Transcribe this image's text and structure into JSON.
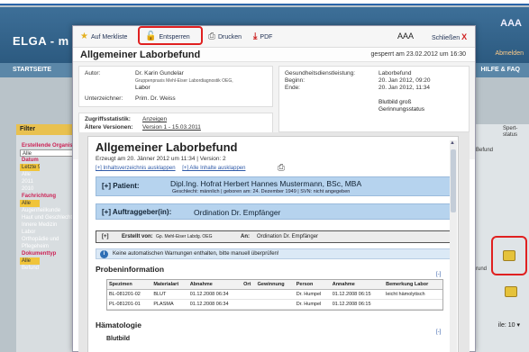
{
  "background": {
    "app_title": "ELGA - m",
    "font_size_control": "AAA",
    "logout": "Abmelden",
    "nav_start": "STARTSEITE",
    "nav_help": "HILFE & FAQ",
    "filter_title": "Filter",
    "filter_items": [
      {
        "label": "Erstellende Organisation",
        "type": "sec"
      },
      {
        "label": "Alle",
        "type": "sel"
      },
      {
        "label": "Datum",
        "type": "sec"
      },
      {
        "label": "Letzte 90 Tage",
        "type": "pill"
      },
      {
        "label": "Alle",
        "type": "plain"
      },
      {
        "label": "2011",
        "type": "plain"
      },
      {
        "label": "2010",
        "type": "plain"
      },
      {
        "label": "Fachrichtung",
        "type": "sec"
      },
      {
        "label": "Alle",
        "type": "pill"
      },
      {
        "label": "Augenheilkunde",
        "type": "plain"
      },
      {
        "label": "Haut und Geschlecht",
        "type": "plain"
      },
      {
        "label": "Innere Medizin",
        "type": "plain"
      },
      {
        "label": "Labor",
        "type": "plain"
      },
      {
        "label": "Orthopädie und",
        "type": "plain"
      },
      {
        "label": "Pflegeheim",
        "type": "plain"
      },
      {
        "label": "Dokumenttyp",
        "type": "sec"
      },
      {
        "label": "Alle",
        "type": "pill"
      },
      {
        "label": "Befund",
        "type": "plain"
      }
    ],
    "right_labels": [
      "Spert-status",
      "Befund",
      "rund"
    ],
    "rows_per_page_label": "ile:",
    "rows_per_page_value": "10"
  },
  "toolbar": {
    "bookmark": "Auf Merkliste",
    "unlock": "Entsperren",
    "print": "Drucken",
    "pdf": "PDF",
    "font_size": "AAA",
    "close": "Schließen",
    "close_x": "X"
  },
  "dialog": {
    "title": "Allgemeiner Laborbefund",
    "locked_status": "gesperrt am 23.02.2012 um 16:30"
  },
  "meta": {
    "author_label": "Autor:",
    "author_name": "Dr. Karin Gundelar",
    "author_org": "Gruppenpraxis Mehl-Eiser Labordiagnostik OEG,",
    "author_dept": "Labor",
    "signer_label": "Unterzeichner:",
    "signer_name": "Prim. Dr. Weiss",
    "service_label": "Gesundheitsdienstleistung:",
    "service_value": "Laborbefund",
    "start_label": "Beginn:",
    "start_value": "20. Jan 2012, 09:20",
    "end_label": "Ende:",
    "end_value": "20. Jan 2012, 11:34",
    "extra_line1": "Blutbild groß",
    "extra_line2": "Gerinnungsstatus",
    "access_label": "Zugriffsstatistik:",
    "access_value": "Anzeigen",
    "versions_label": "Ältere Versionen:",
    "versions_value": "Version 1 - 15.03.2011"
  },
  "doc": {
    "title": "Allgemeiner Laborbefund",
    "subtitle": "Erzeugt am 20. Jänner 2012 um 11:34 | Version: 2",
    "link_toc": "[+] Inhaltsverzeichnis ausklappen",
    "link_all": "[+] Alle Inhalte ausklappen",
    "patient_label": "[+] Patient:",
    "patient_name": "Dipl.Ing. Hofrat Herbert Hannes Mustermann, BSc, MBA",
    "patient_details": "Geschlecht: männlich | geboren am: 24. Dezember 1949 | SVN: nicht angegeben",
    "client_label": "[+] Auftraggeber(in):",
    "client_name": "Ordination Dr. Empfänger",
    "created_toggle": "[+]",
    "created_by_label": "Erstellt von:",
    "created_by_value": "Gp. Mehl-Eiser Labdg. OEG",
    "to_label": "An:",
    "to_value": "Ordination Dr. Empfänger",
    "warning_icon": "i",
    "warning_text": "Keine automatischen Warnungen enthalten, bitte manuell überprüfen!",
    "specimen_title": "Probeninformation",
    "specimen_toggle": "[-]",
    "specimen_headers": [
      "Spezimen",
      "Materialart",
      "Abnahme",
      "Ort",
      "Gewinnung",
      "Person",
      "Annahme",
      "Bemerkung Labor"
    ],
    "specimen_rows": [
      [
        "BL-081201-02",
        "BLUT",
        "01.12.2008 06:34",
        "",
        "",
        "Dr. Humpel",
        "01.12.2008 06:15",
        "leicht hämolytisch"
      ],
      [
        "PL-081201-01",
        "PLASMA",
        "01.12.2008 06:34",
        "",
        "",
        "Dr. Humpel",
        "01.12.2008 06:15",
        ""
      ]
    ],
    "hema_title": "Hämatologie",
    "hema_toggle": "[-]",
    "blood_title": "Blutbild"
  }
}
